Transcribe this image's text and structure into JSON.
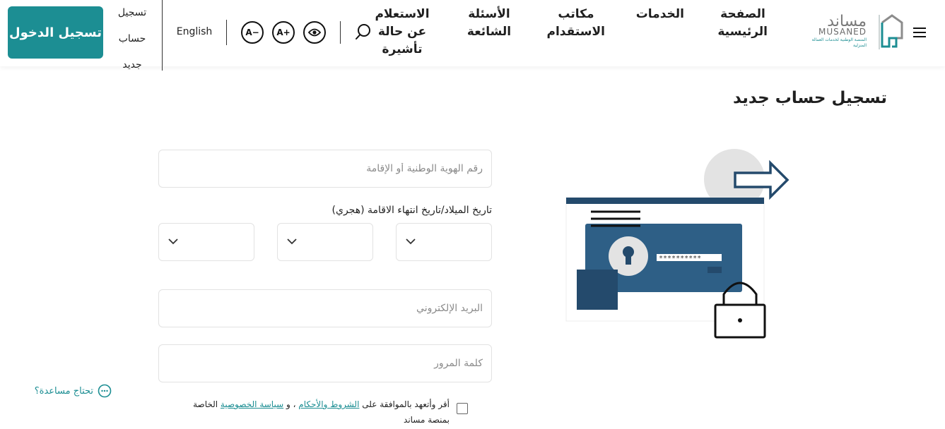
{
  "header": {
    "login_label": "تسجيل الدخول",
    "register_label": "تسجيل حساب جديد",
    "language_label": "English",
    "font_decrease": "A−",
    "font_increase": "A+",
    "nav": [
      {
        "label": "الصفحة الرئيسية"
      },
      {
        "label": "الخدمات"
      },
      {
        "label": "مكاتب الاستقدام"
      },
      {
        "label": "الأسئلة الشائعة"
      },
      {
        "label": "الاستعلام عن حالة تأشيرة"
      }
    ],
    "logo": {
      "name_ar": "مساند",
      "name_en": "MUSANED",
      "subtitle": "المنصة الوطنية لخدمات العمالة المنزلية"
    }
  },
  "main": {
    "title": "تسجيل حساب جديد",
    "id_placeholder": "رقم الهوية الوطنية أو الإقامة",
    "dob_label": "تاريخ الميلاد/تاريخ انتهاء الاقامة (هجري)",
    "email_placeholder": "البريد الإلكتروني",
    "password_placeholder": "كلمة المرور",
    "terms": {
      "prefix": "أقر وأتعهد بالموافقة على",
      "terms_link": "الشروط والأحكام",
      "middle": "، و",
      "privacy_link": "سياسة الخصوصية",
      "suffix": "الخاصة بمنصة مساند"
    },
    "help_label": "تحتاج مساعدة؟",
    "illustration_password": "**********"
  },
  "colors": {
    "primary": "#1c8e93",
    "dark_blue": "#244a6c",
    "card_blue": "#2e5f86"
  }
}
